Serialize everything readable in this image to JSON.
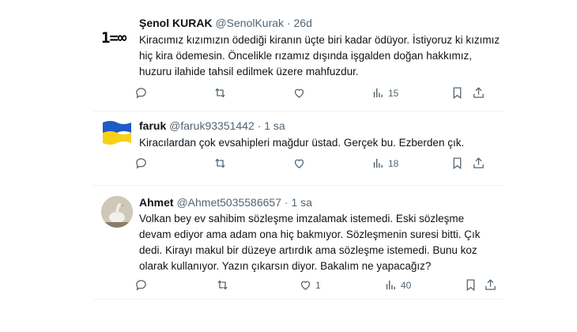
{
  "tweets": [
    {
      "name": "Şenol KURAK",
      "handle": "@SenolKurak",
      "time": "26d",
      "avatar_text": "1=∞",
      "lines": [
        "Kiracımız kızımızın ödediği kiranın üçte biri kadar ödüyor. İstiyoruz ki kızımız",
        "hiç kira ödemesin. Öncelikle rızamız dışında işgalden doğan hakkımız,",
        "huzuru ilahide tahsil edilmek üzere mahfuzdur."
      ],
      "reply_count": "",
      "retweet_count": "",
      "like_count": "",
      "views": "15"
    },
    {
      "name": "faruk",
      "handle": "@faruk93351442",
      "time": "1 sa",
      "lines": [
        "Kiracılardan çok evsahipleri mağdur üstad. Gerçek bu. Ezberden çık."
      ],
      "reply_count": "",
      "retweet_count": "",
      "like_count": "",
      "views": "18"
    },
    {
      "name": "Ahmet",
      "handle": "@Ahmet5035586657",
      "time": "1 sa",
      "lines": [
        "Volkan bey ev sahibim sözleşme imzalamak istemedi. Eski sözleşme",
        "devam ediyor ama adam ona hiç bakmıyor. Sözleşmenin suresi bitti. Çık",
        "dedi. Kirayı makul bir düzeye artırdık ama sözleşme istemedi. Bunu koz",
        "olarak kullanıyor. Yazın çıkarsın diyor. Bakalım ne yapacağız?"
      ],
      "reply_count": "",
      "retweet_count": "",
      "like_count": "1",
      "views": "40"
    }
  ],
  "colors": {
    "text": "#0f1419",
    "muted": "#536471",
    "flag_blue": "#1f5bc6",
    "flag_yellow": "#f7d117"
  },
  "icons": [
    "reply-icon",
    "retweet-icon",
    "like-icon",
    "views-icon",
    "bookmark-icon",
    "share-icon",
    "more-icon"
  ]
}
